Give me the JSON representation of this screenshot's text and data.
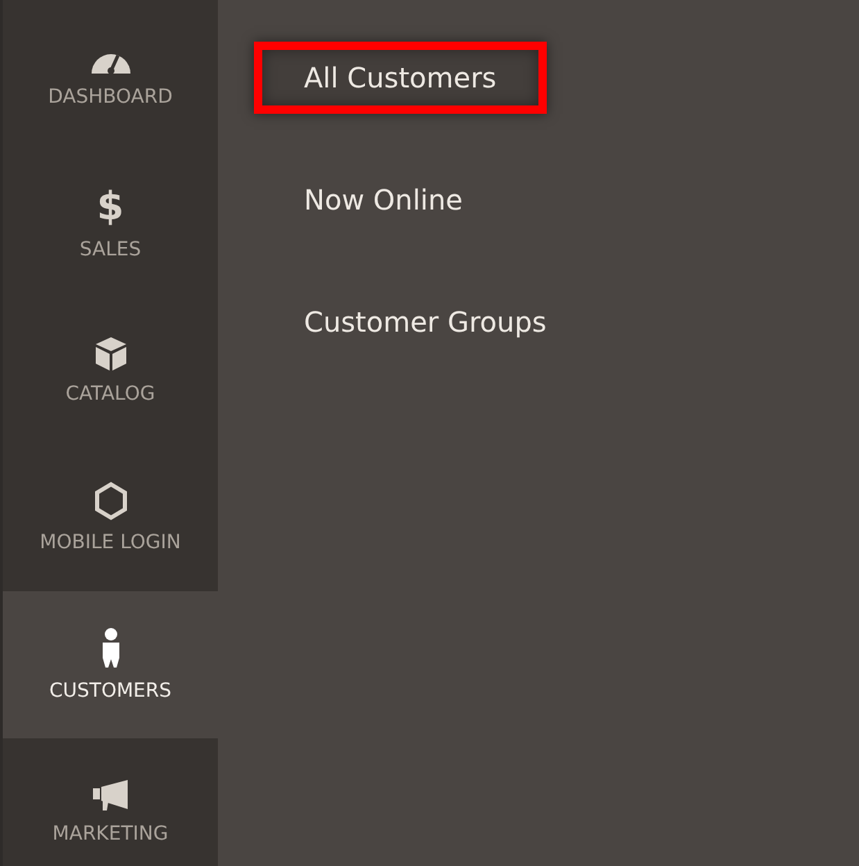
{
  "sidebar": {
    "items": [
      {
        "label": "DASHBOARD",
        "selected": false
      },
      {
        "label": "SALES",
        "glyph": "$",
        "selected": false
      },
      {
        "label": "CATALOG",
        "selected": false
      },
      {
        "label": "MOBILE LOGIN",
        "selected": false
      },
      {
        "label": "CUSTOMERS",
        "selected": true
      },
      {
        "label": "MARKETING",
        "selected": false
      }
    ]
  },
  "submenu": {
    "items": [
      {
        "label": "All Customers",
        "highlighted": true
      },
      {
        "label": "Now Online",
        "highlighted": false
      },
      {
        "label": "Customer Groups",
        "highlighted": false
      }
    ]
  }
}
